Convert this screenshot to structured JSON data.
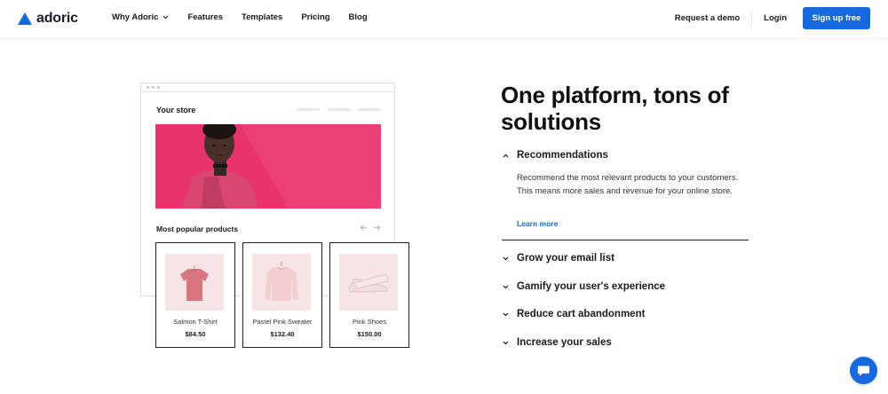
{
  "brand": {
    "name": "adoric",
    "accent": "#1769e0"
  },
  "nav": {
    "items": [
      {
        "label": "Why Adoric",
        "has_dropdown": true
      },
      {
        "label": "Features",
        "has_dropdown": false
      },
      {
        "label": "Templates",
        "has_dropdown": false
      },
      {
        "label": "Pricing",
        "has_dropdown": false
      },
      {
        "label": "Blog",
        "has_dropdown": false
      }
    ],
    "request_demo": "Request a demo",
    "login": "Login",
    "signup": "Sign up free"
  },
  "store_mock": {
    "title": "Your store",
    "section_title": "Most popular products",
    "hero_color": "#e8336f",
    "products": [
      {
        "name": "Salmon T-Shirt",
        "price": "$84.50",
        "icon": "tshirt-icon"
      },
      {
        "name": "Pastel Pink Sweater",
        "price": "$132.40",
        "icon": "sweater-icon"
      },
      {
        "name": "Pink Shoes",
        "price": "$150.00",
        "icon": "shoe-icon"
      }
    ]
  },
  "main": {
    "headline": "One platform, tons of solutions",
    "accordion": {
      "open_item": {
        "title": "Recommendations",
        "description": "Recommend the most relevant products to your customers. This means more sales and revenue for your online store.",
        "link": "Learn more"
      },
      "items": [
        {
          "title": "Grow your email list"
        },
        {
          "title": "Gamify your user's experience"
        },
        {
          "title": "Reduce cart abandonment"
        },
        {
          "title": "Increase your sales"
        }
      ]
    }
  },
  "chat": {
    "icon": "chat-bubble-icon"
  }
}
